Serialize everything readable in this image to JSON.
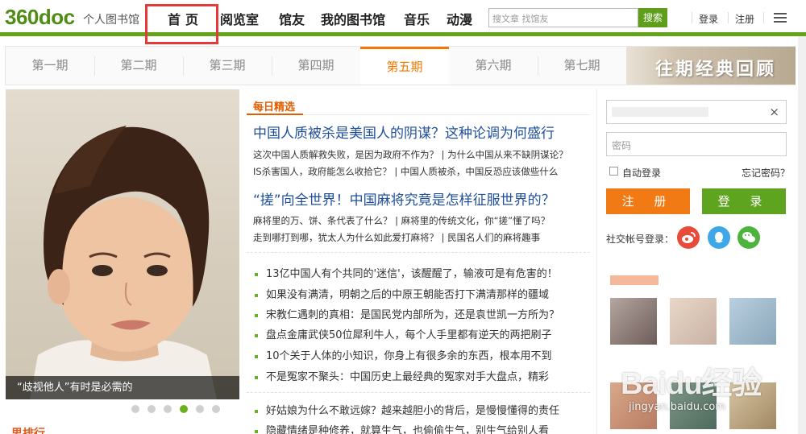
{
  "header": {
    "logo": "360doc",
    "logo_sub": "个人图书馆",
    "nav": [
      "首页",
      "阅览室",
      "馆友",
      "我的图书馆",
      "音乐",
      "动漫"
    ],
    "search_placeholder": "搜文章 找馆友",
    "search_button": "搜索",
    "login": "登录",
    "register": "注册",
    "menu_icon": "hamburger-menu-icon",
    "brand_color": "#63a51a",
    "highlight_color": "#e53a37"
  },
  "issue_tabs": {
    "items": [
      "第一期",
      "第二期",
      "第三期",
      "第四期",
      "第五期",
      "第六期",
      "第七期"
    ],
    "active_index": 4,
    "banner_text": "往期经典回顾",
    "active_color": "#f07800"
  },
  "hero": {
    "caption": "“歧视他人”有时是必需的",
    "slide_count": 6,
    "active_slide": 4
  },
  "daily": {
    "section_title": "每日精选",
    "articles": [
      {
        "headline": "中国人质被杀是美国人的阴谋？这种论调为何盛行",
        "links": [
          "这次中国人质解救失败，是因为政府不作为？ | 为什么中国从来不缺阴谋论？",
          "IS杀害国人，政府能怎么收拾它？ | 中国人质被杀，中国反恐应该做些什么"
        ]
      },
      {
        "headline": "“搓”向全世界！中国麻将究竟是怎样征服世界的？",
        "links": [
          "麻将里的万、饼、条代表了什么？ | 麻将里的传统文化，你“搓”懂了吗？",
          "走到哪打到哪，犹太人为什么如此爱打麻将？ | 民国名人们的麻将趣事"
        ]
      }
    ],
    "bullets": [
      "13亿中国人有个共同的'迷信'，该醒醒了，输液可是有危害的！",
      "如果没有满清，明朝之后的中原王朝能否打下满清那样的疆域",
      "宋教仁遇刺的真相：是国民党内部所为，还是袁世凯一方所为？",
      "盘点金庸武侠50位犀利牛人，每个人手里都有逆天的两把刷子",
      "10个关于人体的小知识，你身上有很多余的东西，根本用不到",
      "不是冤家不聚头：中国历史上最经典的冤家对手大盘点，精彩"
    ],
    "bullets2": [
      "好姑娘为什么不敢远嫁？越来越胆小的背后，是慢慢懂得的责任",
      "隐藏情绪是种修养，就算生气，也偷偷生气，别生气给别人看"
    ]
  },
  "left_label": "思排行",
  "login_panel": {
    "close": "×",
    "password_placeholder": "密码",
    "auto_login": "自动登录",
    "forgot": "忘记密码？",
    "register_button": "注 册",
    "login_button": "登 录",
    "social_label": "社交帐号登录：",
    "social_icons": [
      "weibo-icon",
      "qq-icon",
      "wechat-icon"
    ]
  },
  "watermark": {
    "main": "Baidu经验",
    "sub": "jingyan.baidu.com"
  }
}
